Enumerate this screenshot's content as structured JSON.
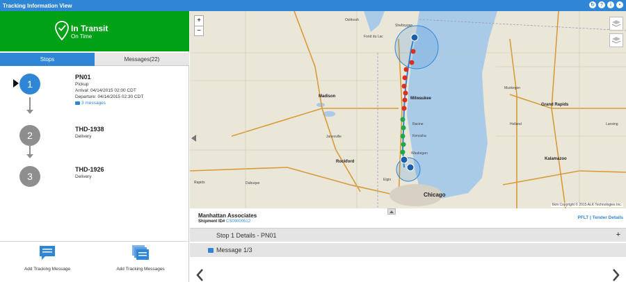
{
  "window": {
    "title": "Tracking Information View",
    "icons": [
      "refresh-icon",
      "help-icon",
      "info-icon",
      "pin-icon"
    ]
  },
  "status": {
    "title": "In Transit",
    "subtitle": "On Time",
    "color": "#00a017"
  },
  "tabs": [
    {
      "label": "Stops",
      "active": true
    },
    {
      "label": "Messages(22)",
      "active": false
    }
  ],
  "stops": [
    {
      "number": "1",
      "name": "PN01",
      "type": "Pickup",
      "arrival": "Arrival: 04/14/2015 02:00 CDT",
      "departure": "Departure: 04/14/2015 02:30 CDT",
      "messages": "3 messages",
      "current": true
    },
    {
      "number": "2",
      "name": "THD-1938",
      "type": "Delivery",
      "current": false
    },
    {
      "number": "3",
      "name": "THD-1926",
      "type": "Delivery",
      "current": false
    }
  ],
  "actions": {
    "add_one": "Add Tracking Message",
    "add_many": "Add Tracking Messages"
  },
  "map": {
    "zoom_in": "+",
    "zoom_out": "−",
    "copyright": "Copyright © 2015 ALK Technologies Inc.",
    "scale": "6km",
    "cities": {
      "milwaukee": "Milwaukee",
      "chicago": "Chicago",
      "madison": "Madison",
      "grand_rapids": "Grand Rapids",
      "rockford": "Rockford",
      "kalamazoo": "Kalamazoo",
      "kenosha": "Kenosha",
      "waukegan": "Waukegan",
      "fond_du_lac": "Fond du Lac",
      "elgin": "Elgin",
      "racine": "Racine",
      "sheboygan": "Sheboygan",
      "muskegon": "Muskegon",
      "lansing": "Lansing",
      "holland": "Holland",
      "janesville": "Janesville",
      "oshkosh": "Oshkosh",
      "dubuque": "Dubuque",
      "rapids": "Rapids"
    }
  },
  "summary": {
    "company": "Manhattan Associates",
    "shipment_label": "Shipment ID#",
    "shipment_id": "CS00000512",
    "links": "PFLT | Tender Details"
  },
  "details": {
    "title": "Stop 1 Details - PN01",
    "expand": "+"
  },
  "message": {
    "title": "Message 1/3"
  },
  "colors": {
    "accent": "#2f86d6",
    "success": "#00a017",
    "alert": "#d93025",
    "lake": "#a9cbe8"
  }
}
